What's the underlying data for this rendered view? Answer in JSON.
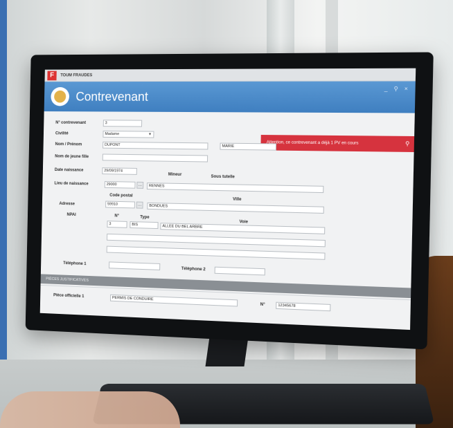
{
  "window": {
    "app_icon": "F",
    "title": "TOUM FRAUDES",
    "controls": [
      "_",
      "⚲",
      "×"
    ]
  },
  "header": {
    "title": "Contrevenant"
  },
  "alert": {
    "text": "Attention, ce contrevenant a déjà 1 PV en cours",
    "icon": "search-icon"
  },
  "form": {
    "num_contrevenant_label": "N° contrevenant",
    "num_contrevenant_value": "3",
    "civilite_label": "Civilité",
    "civilite_value": "Madame",
    "nom_prenom_label": "Nom / Prénom",
    "nom_value": "DUPONT",
    "prenom_value": "MARIE",
    "nom_jeune_fille_label": "Nom de jeune fille",
    "nom_jeune_fille_value": "",
    "date_naissance_label": "Date naissance",
    "date_naissance_value": "29/09/1974",
    "mineur_label": "Mineur",
    "sous_tutelle_label": "Sous tutelle",
    "lieu_naissance_label": "Lieu de naissance",
    "lieu_code_value": "29000",
    "lieu_ville_value": "RENNES",
    "code_postal_label": "Code postal",
    "ville_label": "Ville",
    "adresse_label": "Adresse",
    "adresse_cp_value": "59910",
    "adresse_ville_value": "BONDUES",
    "npai_label": "NPAI",
    "numero_label": "N°",
    "type_label": "Type",
    "voie_label": "Voie",
    "numero_value": "3",
    "type_value": "BIS",
    "voie_value": "ALLEE DU BEL ARBRE",
    "adresse_ligne2_value": "",
    "adresse_ligne3_value": "",
    "telephone1_label": "Téléphone 1",
    "telephone1_value": "",
    "telephone2_label": "Téléphone 2",
    "telephone2_value": ""
  },
  "pieces": {
    "section_title": "PIÈCES JUSTIFICATIVES",
    "piece_officielle_label": "Pièce officielle 1",
    "piece_officielle_value": "PERMIS DE CONDUIRE",
    "numero_label": "N°",
    "numero_value": "12345678"
  },
  "colors": {
    "header_blue": "#4a8ccc",
    "alert_red": "#d6333e",
    "section_gray": "#8a8f94"
  }
}
